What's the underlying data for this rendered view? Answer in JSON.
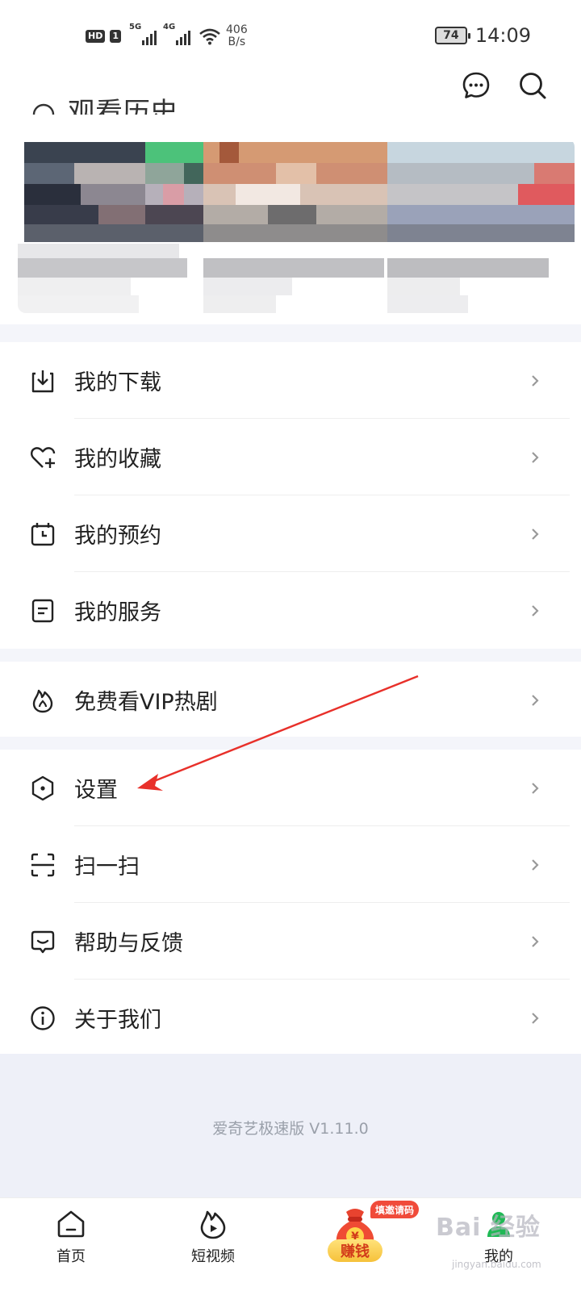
{
  "status_bar": {
    "hd": "HD",
    "sim": "1",
    "net1": "5G",
    "net2": "4G",
    "speed_value": "406",
    "speed_unit": "B/s",
    "battery": "74",
    "time": "14:09"
  },
  "header": {
    "partial_title": "观看历史",
    "icons": [
      "message-icon",
      "search-icon"
    ]
  },
  "menu_group_1": [
    {
      "label": "我的下载",
      "icon": "download-icon"
    },
    {
      "label": "我的收藏",
      "icon": "heart-plus-icon"
    },
    {
      "label": "我的预约",
      "icon": "calendar-clock-icon"
    },
    {
      "label": "我的服务",
      "icon": "document-icon"
    }
  ],
  "menu_group_2": [
    {
      "label": "免费看VIP热剧",
      "icon": "flame-icon"
    }
  ],
  "menu_group_3": [
    {
      "label": "设置",
      "icon": "hexagon-settings-icon"
    },
    {
      "label": "扫一扫",
      "icon": "scan-icon"
    },
    {
      "label": "帮助与反馈",
      "icon": "chat-feedback-icon"
    },
    {
      "label": "关于我们",
      "icon": "info-icon"
    }
  ],
  "version": "爱奇艺极速版 V1.11.0",
  "bottom_nav": {
    "home": "首页",
    "short_video": "短视频",
    "earn": "赚钱",
    "earn_badge": "填邀请码",
    "mine": "我的",
    "active": "mine"
  },
  "watermark": {
    "main": "Bai 经验",
    "sub": "jingyan.baidu.com"
  },
  "colors": {
    "accent_green": "#1fb955",
    "annotation_red": "#e8302a",
    "band_bg": "#f4f5fa"
  }
}
